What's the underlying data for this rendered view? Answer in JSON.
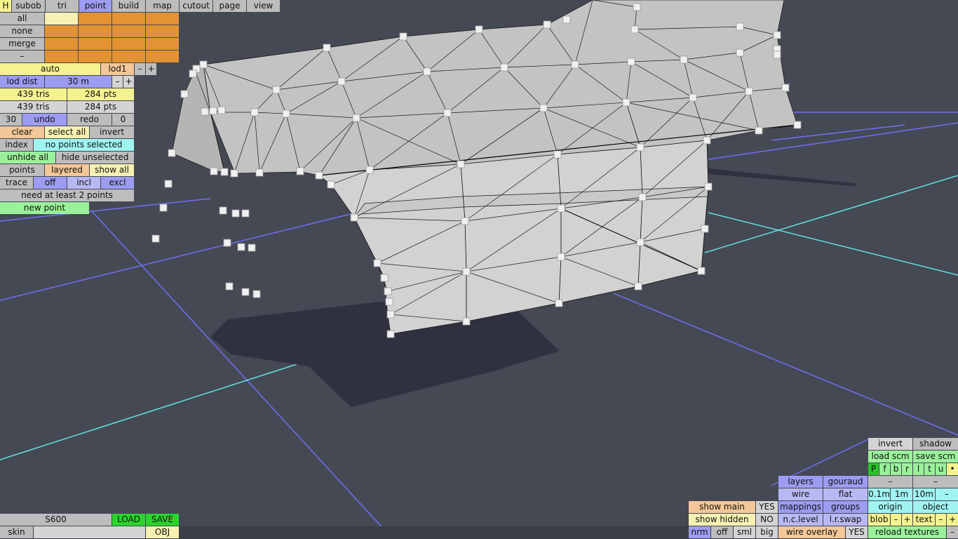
{
  "top_tabs": {
    "h": "H",
    "subob": "subob",
    "tri": "tri",
    "point": "point",
    "build": "build",
    "map": "map",
    "cutout": "cutout",
    "page": "page",
    "view": "view"
  },
  "select_grid": {
    "all": "all",
    "none": "none",
    "merge": "merge",
    "minus": "–"
  },
  "lod": {
    "auto": "auto",
    "lod1": "lod1",
    "minus": "–",
    "plus": "+",
    "lod_dist": "lod dist",
    "dist_value": "30 m"
  },
  "stats": {
    "tris_a": "439 tris",
    "pts_a": "284 pts",
    "tris_b": "439 tris",
    "pts_b": "284 pts"
  },
  "history": {
    "count_left": "30",
    "undo": "undo",
    "redo": "redo",
    "count_right": "0"
  },
  "selection": {
    "clear": "clear",
    "select_all": "select all",
    "invert": "invert",
    "index": "index",
    "status": "no points selected"
  },
  "visibility": {
    "unhide_all": "unhide all",
    "hide_unselected": "hide unselected",
    "points": "points",
    "layered": "layered",
    "show_all": "show all"
  },
  "trace": {
    "trace": "trace",
    "off": "off",
    "incl": "incl",
    "excl": "excl",
    "hint": "need at least 2 points",
    "new_point": "new point"
  },
  "file": {
    "name": "S600",
    "load": "LOAD",
    "save": "SAVE",
    "skin": "skin",
    "format": "OBJ"
  },
  "display": {
    "show_main": "show main",
    "show_main_val": "YES",
    "show_hidden": "show hidden",
    "show_hidden_val": "NO",
    "nrm": "nrm",
    "off": "off",
    "sml": "sml",
    "big": "big",
    "layers": "layers",
    "gouraud": "gouraud",
    "wire": "wire",
    "flat": "flat",
    "mappings": "mappings",
    "groups": "groups",
    "nc_level": "n.c.level",
    "lr_swap": "l.r.swap",
    "wire_overlay": "wire overlay",
    "wire_overlay_val": "YES"
  },
  "view_controls": {
    "invert": "invert",
    "shadow": "shadow",
    "load_scm": "load scm",
    "save_scm": "save scm",
    "letters": [
      "P",
      "f",
      "b",
      "r",
      "l",
      "t",
      "u",
      "•"
    ],
    "minus_a": "–",
    "minus_b": "–",
    "step_01": "0.1m",
    "step_1": "1m",
    "step_10": "10m",
    "step_minus": "–",
    "origin": "origin",
    "object": "object",
    "blob": "blob",
    "blob_minus": "–",
    "blob_plus": "+",
    "text": "text",
    "text_minus": "–",
    "text_plus": "+",
    "reload_textures": "reload textures",
    "reload_minus": "–"
  },
  "colors": {
    "background": "#454954",
    "mesh_fill": "#bfbfbf",
    "grid_blue": "#6f6ff2",
    "grid_cyan": "#62e3e0",
    "shadow": "#2f3140",
    "vertex": "#f0f0f0"
  }
}
